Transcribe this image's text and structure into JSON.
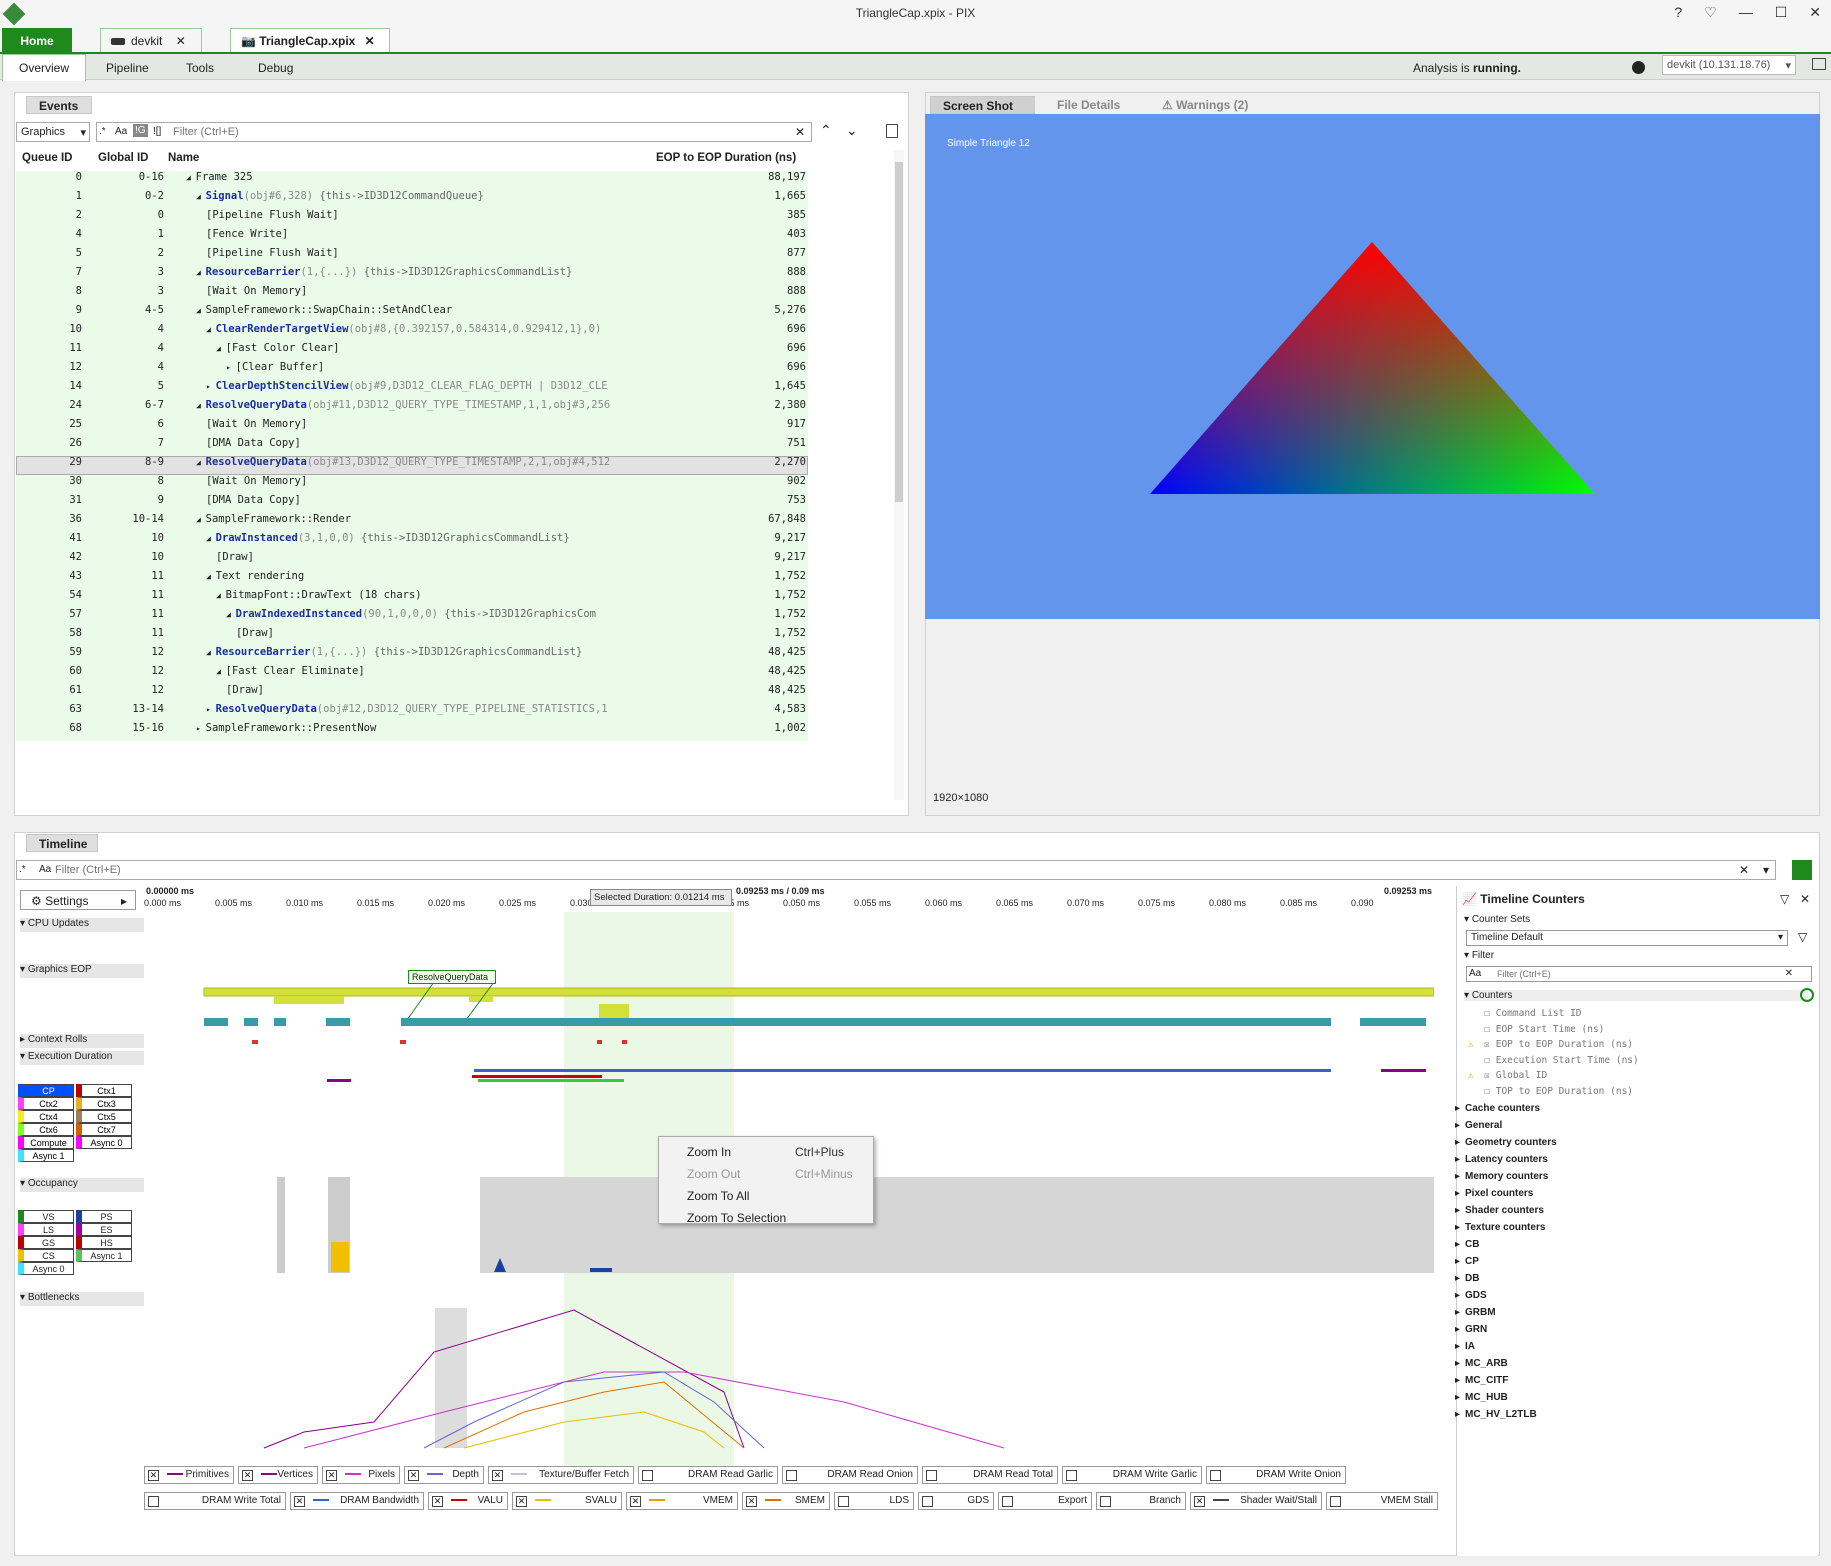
{
  "window": {
    "title": "TriangleCap.xpix - PIX",
    "controls": [
      "?",
      "♡",
      "—",
      "☐",
      "✕"
    ]
  },
  "tabs": {
    "home": "Home",
    "devkit": "devkit",
    "capture": "TriangleCap.xpix"
  },
  "nav": {
    "overview": "Overview",
    "pipeline": "Pipeline",
    "tools": "Tools",
    "debug": "Debug",
    "status_prefix": "Analysis is",
    "status_value": "running.",
    "device": "devkit (10.131.18.76)"
  },
  "events": {
    "title": "Events",
    "queue_select": "Graphics",
    "filter_placeholder": "Filter (Ctrl+E)",
    "toggles": [
      ".*",
      "Aa",
      "!G",
      "![]"
    ],
    "columns": [
      "Queue ID",
      "Global ID",
      "Name",
      "EOP to EOP Duration (ns)"
    ],
    "rows": [
      {
        "q": "0",
        "g": "0-16",
        "pre": "◢ ",
        "fn": "",
        "plain": "Frame 325",
        "args": "",
        "cmt": "",
        "d": "88,197",
        "ind": 0
      },
      {
        "q": "1",
        "g": "0-2",
        "pre": "◢ ",
        "fn": "Signal",
        "plain": "",
        "args": "(obj#6,328)",
        "cmt": "  {this->ID3D12CommandQueue}",
        "d": "1,665",
        "ind": 1
      },
      {
        "q": "2",
        "g": "0",
        "pre": "",
        "fn": "",
        "plain": "[Pipeline Flush Wait]",
        "args": "",
        "cmt": "",
        "d": "385",
        "ind": 2
      },
      {
        "q": "4",
        "g": "1",
        "pre": "",
        "fn": "",
        "plain": "[Fence Write]",
        "args": "",
        "cmt": "",
        "d": "403",
        "ind": 2
      },
      {
        "q": "5",
        "g": "2",
        "pre": "",
        "fn": "",
        "plain": "[Pipeline Flush Wait]",
        "args": "",
        "cmt": "",
        "d": "877",
        "ind": 2
      },
      {
        "q": "7",
        "g": "3",
        "pre": "◢ ",
        "fn": "ResourceBarrier",
        "plain": "",
        "args": "(1,{...})",
        "cmt": "  {this->ID3D12GraphicsCommandList}",
        "d": "888",
        "ind": 1
      },
      {
        "q": "8",
        "g": "3",
        "pre": "",
        "fn": "",
        "plain": "[Wait On Memory]",
        "args": "",
        "cmt": "",
        "d": "888",
        "ind": 2
      },
      {
        "q": "9",
        "g": "4-5",
        "pre": "◢ ",
        "fn": "",
        "plain": "SampleFramework::SwapChain::SetAndClear",
        "args": "",
        "cmt": "",
        "d": "5,276",
        "ind": 1
      },
      {
        "q": "10",
        "g": "4",
        "pre": "◢ ",
        "fn": "ClearRenderTargetView",
        "plain": "",
        "args": "(obj#8,{0.392157,0.584314,0.929412,1},0)",
        "cmt": "",
        "d": "696",
        "ind": 2
      },
      {
        "q": "11",
        "g": "4",
        "pre": "◢ ",
        "fn": "",
        "plain": "[Fast Color Clear]",
        "args": "",
        "cmt": "",
        "d": "696",
        "ind": 3
      },
      {
        "q": "12",
        "g": "4",
        "pre": "▸ ",
        "fn": "",
        "plain": "[Clear Buffer]",
        "args": "",
        "cmt": "",
        "d": "696",
        "ind": 4
      },
      {
        "q": "14",
        "g": "5",
        "pre": "▸ ",
        "fn": "ClearDepthStencilView",
        "plain": "",
        "args": "(obj#9,D3D12_CLEAR_FLAG_DEPTH | D3D12_CLE",
        "cmt": "",
        "d": "1,645",
        "ind": 2
      },
      {
        "q": "24",
        "g": "6-7",
        "pre": "◢ ",
        "fn": "ResolveQueryData",
        "plain": "",
        "args": "(obj#11,D3D12_QUERY_TYPE_TIMESTAMP,1,1,obj#3,256",
        "cmt": "",
        "d": "2,380",
        "ind": 1
      },
      {
        "q": "25",
        "g": "6",
        "pre": "",
        "fn": "",
        "plain": "[Wait On Memory]",
        "args": "",
        "cmt": "",
        "d": "917",
        "ind": 2
      },
      {
        "q": "26",
        "g": "7",
        "pre": "",
        "fn": "",
        "plain": "[DMA Data Copy]",
        "args": "",
        "cmt": "",
        "d": "751",
        "ind": 2
      },
      {
        "q": "29",
        "g": "8-9",
        "pre": "◢ ",
        "fn": "ResolveQueryData",
        "plain": "",
        "args": "(obj#13,D3D12_QUERY_TYPE_TIMESTAMP,2,1,obj#4,512",
        "cmt": "",
        "d": "2,270",
        "ind": 1,
        "sel": true
      },
      {
        "q": "30",
        "g": "8",
        "pre": "",
        "fn": "",
        "plain": "[Wait On Memory]",
        "args": "",
        "cmt": "",
        "d": "902",
        "ind": 2
      },
      {
        "q": "31",
        "g": "9",
        "pre": "",
        "fn": "",
        "plain": "[DMA Data Copy]",
        "args": "",
        "cmt": "",
        "d": "753",
        "ind": 2
      },
      {
        "q": "36",
        "g": "10-14",
        "pre": "◢ ",
        "fn": "",
        "plain": "SampleFramework::Render",
        "args": "",
        "cmt": "",
        "d": "67,848",
        "ind": 1
      },
      {
        "q": "41",
        "g": "10",
        "pre": "◢ ",
        "fn": "DrawInstanced",
        "plain": "",
        "args": "(3,1,0,0)",
        "cmt": "  {this->ID3D12GraphicsCommandList}",
        "d": "9,217",
        "ind": 2
      },
      {
        "q": "42",
        "g": "10",
        "pre": "",
        "fn": "",
        "plain": "[Draw]",
        "args": "",
        "cmt": "",
        "d": "9,217",
        "ind": 3
      },
      {
        "q": "43",
        "g": "11",
        "pre": "◢ ",
        "fn": "",
        "plain": "Text rendering",
        "args": "",
        "cmt": "",
        "d": "1,752",
        "ind": 2
      },
      {
        "q": "54",
        "g": "11",
        "pre": "◢ ",
        "fn": "",
        "plain": "BitmapFont::DrawText (18 chars)",
        "args": "",
        "cmt": "",
        "d": "1,752",
        "ind": 3
      },
      {
        "q": "57",
        "g": "11",
        "pre": "◢ ",
        "fn": "DrawIndexedInstanced",
        "plain": "",
        "args": "(90,1,0,0,0)",
        "cmt": "  {this->ID3D12GraphicsCom",
        "d": "1,752",
        "ind": 4
      },
      {
        "q": "58",
        "g": "11",
        "pre": "",
        "fn": "",
        "plain": "[Draw]",
        "args": "",
        "cmt": "",
        "d": "1,752",
        "ind": 5
      },
      {
        "q": "59",
        "g": "12",
        "pre": "◢ ",
        "fn": "ResourceBarrier",
        "plain": "",
        "args": "(1,{...})",
        "cmt": "  {this->ID3D12GraphicsCommandList}",
        "d": "48,425",
        "ind": 2
      },
      {
        "q": "60",
        "g": "12",
        "pre": "◢ ",
        "fn": "",
        "plain": "[Fast Clear Eliminate]",
        "args": "",
        "cmt": "",
        "d": "48,425",
        "ind": 3
      },
      {
        "q": "61",
        "g": "12",
        "pre": "",
        "fn": "",
        "plain": "[Draw]",
        "args": "",
        "cmt": "",
        "d": "48,425",
        "ind": 4
      },
      {
        "q": "63",
        "g": "13-14",
        "pre": "▸ ",
        "fn": "ResolveQueryData",
        "plain": "",
        "args": "(obj#12,D3D12_QUERY_TYPE_PIPELINE_STATISTICS,1",
        "cmt": "",
        "d": "4,583",
        "ind": 2
      },
      {
        "q": "68",
        "g": "15-16",
        "pre": "▸ ",
        "fn": "",
        "plain": "SampleFramework::PresentNow",
        "args": "",
        "cmt": "",
        "d": "1,002",
        "ind": 1
      }
    ]
  },
  "screenshot": {
    "tabs": [
      "Screen Shot",
      "File Details",
      "Warnings (2)"
    ],
    "overlay_text": "Simple Triangle 12",
    "resolution": "1920×1080"
  },
  "timeline": {
    "title": "Timeline",
    "filter_placeholder": "Filter (Ctrl+E)",
    "settings": "Settings",
    "start": "0.00000 ms",
    "range": "0.09253 ms / 0.09 ms",
    "end": "0.09253 ms",
    "selected": "Selected Duration: 0.01214 ms",
    "ticks": [
      "0.000 ms",
      "0.005 ms",
      "0.010 ms",
      "0.015 ms",
      "0.020 ms",
      "0.025 ms",
      "0.030",
      "",
      "0.045 ms",
      "0.050 ms",
      "0.055 ms",
      "0.060 ms",
      "0.065 ms",
      "0.070 ms",
      "0.075 ms",
      "0.080 ms",
      "0.085 ms",
      "0.090"
    ],
    "lanes": {
      "cpu": "CPU Updates",
      "eop": "Graphics EOP",
      "ctxrolls": "Context Rolls",
      "exec": "Execution Duration",
      "occ": "Occupancy",
      "bottlenecks": "Bottlenecks"
    },
    "tooltip": "ResolveQueryData",
    "ctx_legend": [
      "CP",
      "Ctx1",
      "Ctx2",
      "Ctx3",
      "Ctx4",
      "Ctx5",
      "Ctx6",
      "Ctx7",
      "Compute",
      "Async 0",
      "Async 1"
    ],
    "occ_legend": [
      "VS",
      "PS",
      "LS",
      "ES",
      "GS",
      "HS",
      "CS",
      "Async 1",
      "Async 0"
    ],
    "context_menu": [
      {
        "label": "Zoom In",
        "shortcut": "Ctrl+Plus",
        "disabled": false
      },
      {
        "label": "Zoom Out",
        "shortcut": "Ctrl+Minus",
        "disabled": true
      },
      {
        "label": "Zoom To All",
        "shortcut": "",
        "disabled": false
      },
      {
        "label": "Zoom To Selection",
        "shortcut": "",
        "disabled": false
      }
    ],
    "checks_row1": [
      {
        "l": "Primitives",
        "on": true,
        "c": "#8b008b"
      },
      {
        "l": "Vertices",
        "on": true,
        "c": "#8b008b"
      },
      {
        "l": "Pixels",
        "on": true,
        "c": "#cc33cc"
      },
      {
        "l": "Depth",
        "on": true,
        "c": "#6666cc"
      },
      {
        "l": "Texture/Buffer Fetch",
        "on": true,
        "c": "#c0c0e0"
      },
      {
        "l": "DRAM Read Garlic",
        "on": false,
        "c": ""
      },
      {
        "l": "DRAM Read Onion",
        "on": false,
        "c": ""
      },
      {
        "l": "DRAM Read Total",
        "on": false,
        "c": ""
      },
      {
        "l": "DRAM Write Garlic",
        "on": false,
        "c": ""
      },
      {
        "l": "DRAM Write Onion",
        "on": false,
        "c": ""
      }
    ],
    "checks_row2": [
      {
        "l": "DRAM Write Total",
        "on": false,
        "c": ""
      },
      {
        "l": "DRAM Bandwidth",
        "on": true,
        "c": "#3366cc"
      },
      {
        "l": "VALU",
        "on": true,
        "c": "#cc0000"
      },
      {
        "l": "SVALU",
        "on": true,
        "c": "#e6c000"
      },
      {
        "l": "VMEM",
        "on": true,
        "c": "#e6a000"
      },
      {
        "l": "SMEM",
        "on": true,
        "c": "#e07000"
      },
      {
        "l": "LDS",
        "on": false,
        "c": ""
      },
      {
        "l": "GDS",
        "on": false,
        "c": ""
      },
      {
        "l": "Export",
        "on": false,
        "c": ""
      },
      {
        "l": "Branch",
        "on": false,
        "c": ""
      },
      {
        "l": "Shader Wait/Stall",
        "on": true,
        "c": "#444"
      },
      {
        "l": "VMEM Stall",
        "on": false,
        "c": ""
      }
    ]
  },
  "counters": {
    "title": "Timeline Counters",
    "sets_label": "Counter Sets",
    "set_value": "Timeline Default",
    "filter_label": "Filter",
    "filter_placeholder": "Filter (Ctrl+E)",
    "counters_label": "Counters",
    "items": [
      {
        "l": "Command List ID",
        "on": false,
        "warn": false
      },
      {
        "l": "EOP Start Time (ns)",
        "on": false,
        "warn": false
      },
      {
        "l": "EOP to EOP Duration (ns)",
        "on": true,
        "warn": true
      },
      {
        "l": "Execution Start Time (ns)",
        "on": false,
        "warn": false
      },
      {
        "l": "Global ID",
        "on": true,
        "warn": true
      },
      {
        "l": "TOP to EOP Duration (ns)",
        "on": false,
        "warn": false
      }
    ],
    "groups": [
      "Cache counters",
      "General",
      "Geometry counters",
      "Latency counters",
      "Memory counters",
      "Pixel counters",
      "Shader counters",
      "Texture counters",
      "CB",
      "CP",
      "DB",
      "GDS",
      "GRBM",
      "GRN",
      "IA",
      "MC_ARB",
      "MC_CITF",
      "MC_HUB",
      "MC_HV_L2TLB"
    ]
  },
  "colors": {
    "accent": "#1e8a1e",
    "screen_bg": "#6495ed",
    "row_bg": "#eafbea",
    "eop_bar": "#d4e03a",
    "exec_bar": "#3a9aaa"
  }
}
